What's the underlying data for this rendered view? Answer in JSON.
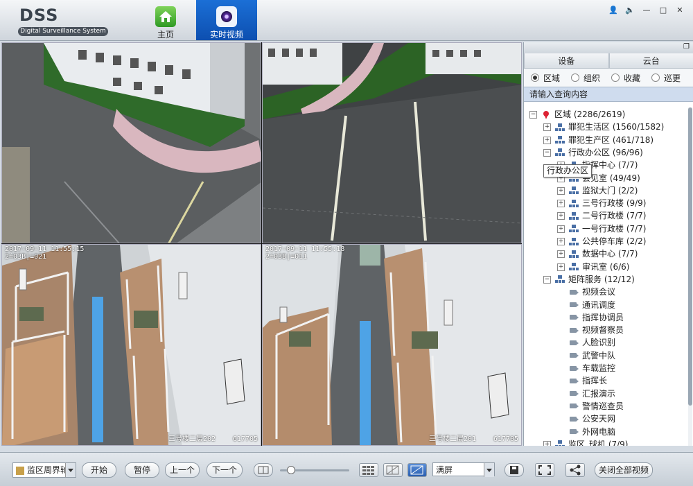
{
  "titlebar": {
    "logo": "DSS",
    "logo_sub": "Digital Surveillance System",
    "tabs": [
      {
        "label": "主页",
        "icon": "home-icon"
      },
      {
        "label": "实时视频",
        "icon": "camera-icon",
        "active": true
      }
    ]
  },
  "videos": [
    {
      "timestamp": "",
      "camera": "",
      "bottom_left": "",
      "bottom_right": ""
    },
    {
      "timestamp": "",
      "camera": "",
      "bottom_left": "",
      "bottom_right": ""
    },
    {
      "timestamp": "2017-09-11 11:55:15",
      "camera": "2≟03B|≡021",
      "bottom_left": "三号楼二层202",
      "bottom_right": "617705"
    },
    {
      "timestamp": "2017-09-11 11:55:18",
      "camera": "2≟03B|≡011",
      "bottom_left": "三号楼二层201",
      "bottom_right": "617705"
    }
  ],
  "panel": {
    "tabs": [
      "设备",
      "云台"
    ],
    "radios": [
      {
        "label": "区域",
        "selected": true
      },
      {
        "label": "组织",
        "selected": false
      },
      {
        "label": "收藏",
        "selected": false
      },
      {
        "label": "巡更",
        "selected": false
      }
    ],
    "search_placeholder": "请输入查询内容",
    "tooltip": "行政办公区",
    "tree": [
      {
        "label": "区域 (2286/2619)",
        "level": 0,
        "exp": "−",
        "icon": "pin"
      },
      {
        "label": "罪犯生活区 (1560/1582)",
        "level": 1,
        "exp": "+",
        "icon": "org"
      },
      {
        "label": "罪犯生产区 (461/718)",
        "level": 1,
        "exp": "+",
        "icon": "org"
      },
      {
        "label": "行政办公区 (96/96)",
        "level": 1,
        "exp": "−",
        "icon": "org"
      },
      {
        "label": "指挥中心 (7/7)",
        "level": 2,
        "exp": "+",
        "icon": "org"
      },
      {
        "label": "会见室 (49/49)",
        "level": 2,
        "exp": "+",
        "icon": "org"
      },
      {
        "label": "监狱大门 (2/2)",
        "level": 2,
        "exp": "+",
        "icon": "org"
      },
      {
        "label": "三号行政楼 (9/9)",
        "level": 2,
        "exp": "+",
        "icon": "org"
      },
      {
        "label": "二号行政楼 (7/7)",
        "level": 2,
        "exp": "+",
        "icon": "org"
      },
      {
        "label": "一号行政楼 (7/7)",
        "level": 2,
        "exp": "+",
        "icon": "org"
      },
      {
        "label": "公共停车库 (2/2)",
        "level": 2,
        "exp": "+",
        "icon": "org"
      },
      {
        "label": "数据中心 (7/7)",
        "level": 2,
        "exp": "+",
        "icon": "org"
      },
      {
        "label": "审讯室 (6/6)",
        "level": 2,
        "exp": "+",
        "icon": "org"
      },
      {
        "label": "矩阵服务 (12/12)",
        "level": 1,
        "exp": "−",
        "icon": "org"
      },
      {
        "label": "视频会议",
        "level": 2,
        "exp": "",
        "icon": "cam"
      },
      {
        "label": "通讯调度",
        "level": 2,
        "exp": "",
        "icon": "cam"
      },
      {
        "label": "指挥协调员",
        "level": 2,
        "exp": "",
        "icon": "cam"
      },
      {
        "label": "视频督察员",
        "level": 2,
        "exp": "",
        "icon": "cam"
      },
      {
        "label": "人脸识别",
        "level": 2,
        "exp": "",
        "icon": "cam"
      },
      {
        "label": "武警中队",
        "level": 2,
        "exp": "",
        "icon": "cam"
      },
      {
        "label": "车载监控",
        "level": 2,
        "exp": "",
        "icon": "cam"
      },
      {
        "label": "指挥长",
        "level": 2,
        "exp": "",
        "icon": "cam"
      },
      {
        "label": "汇报演示",
        "level": 2,
        "exp": "",
        "icon": "cam"
      },
      {
        "label": "警情巡查员",
        "level": 2,
        "exp": "",
        "icon": "cam"
      },
      {
        "label": "公安天网",
        "level": 2,
        "exp": "",
        "icon": "cam"
      },
      {
        "label": "外网电脑",
        "level": 2,
        "exp": "",
        "icon": "cam"
      },
      {
        "label": "监区_球机 (7/9)",
        "level": 1,
        "exp": "+",
        "icon": "org"
      }
    ]
  },
  "toolbar": {
    "sequence_select": "监区周界轮",
    "start": "开始",
    "pause": "暂停",
    "prev": "上一个",
    "next": "下一个",
    "layout_select": "满屏",
    "close_all": "关闭全部视频"
  }
}
